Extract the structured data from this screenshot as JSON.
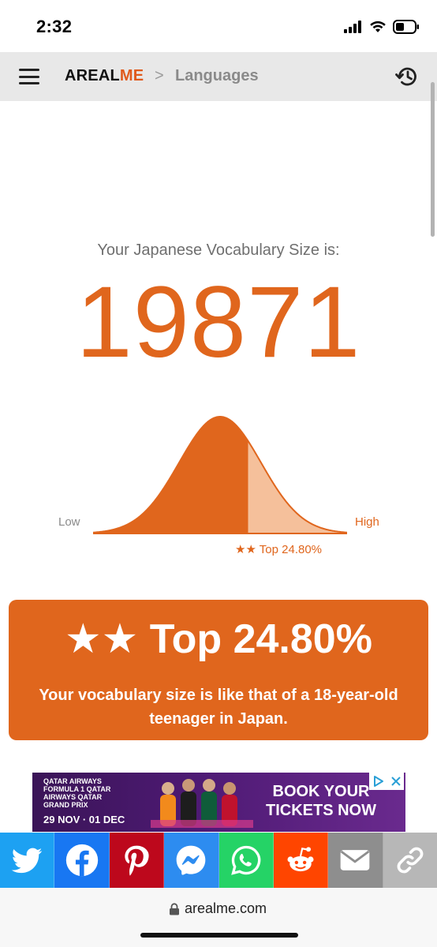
{
  "status_bar": {
    "time": "2:32"
  },
  "nav": {
    "brand_main": "AREAL",
    "brand_accent": "ME",
    "separator": ">",
    "breadcrumb": "Languages"
  },
  "result": {
    "label": "Your Japanese Vocabulary Size is:",
    "value": "19871",
    "chart_low_label": "Low",
    "chart_high_label": "High",
    "chart_caption": "★★ Top 24.80%",
    "top_fraction": 0.248
  },
  "card": {
    "headline": "★★ Top 24.80%",
    "description": "Your vocabulary size is like that of a 18-year-old teenager in Japan."
  },
  "ad": {
    "brand_text": "QATAR AIRWAYS FORMULA 1 QATAR AIRWAYS QATAR GRAND PRIX",
    "date": "29 NOV · 01 DEC",
    "cta": "BOOK YOUR TICKETS NOW"
  },
  "share": [
    {
      "name": "twitter",
      "icon": "twitter-icon",
      "color": "#1da1f2"
    },
    {
      "name": "facebook",
      "icon": "facebook-icon",
      "color": "#1877f2"
    },
    {
      "name": "pinterest",
      "icon": "pinterest-icon",
      "color": "#bd081c"
    },
    {
      "name": "messenger",
      "icon": "messenger-icon",
      "color": "#2d8cf0"
    },
    {
      "name": "whatsapp",
      "icon": "whatsapp-icon",
      "color": "#25d366"
    },
    {
      "name": "reddit",
      "icon": "reddit-icon",
      "color": "#ff4500"
    },
    {
      "name": "email",
      "icon": "email-icon",
      "color": "#8e8e8e"
    },
    {
      "name": "link",
      "icon": "link-icon",
      "color": "#b7b7b7"
    }
  ],
  "url_bar": {
    "domain": "arealme.com"
  },
  "colors": {
    "accent": "#e0661d",
    "nav_bg": "#e8e8e8"
  }
}
